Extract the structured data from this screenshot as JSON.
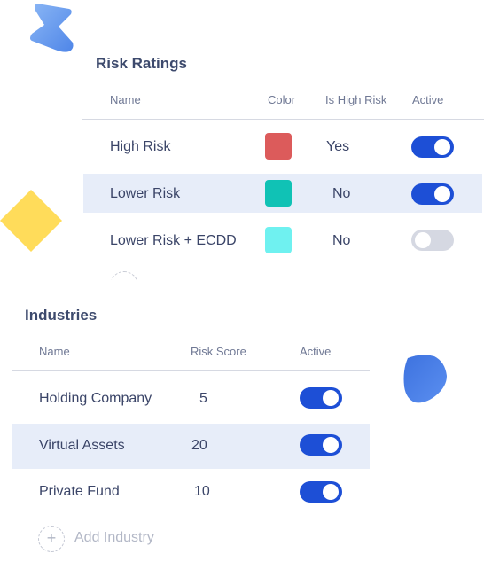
{
  "risk_ratings": {
    "title": "Risk Ratings",
    "columns": [
      "Name",
      "Color",
      "Is High Risk",
      "Active"
    ],
    "rows": [
      {
        "name": "High Risk",
        "color": "#dc5b5b",
        "is_high_risk": "Yes",
        "active": true
      },
      {
        "name": "Lower Risk",
        "color": "#10c2b5",
        "is_high_risk": "No",
        "active": true
      },
      {
        "name": "Lower Risk + ECDD",
        "color": "#6ff1f0",
        "is_high_risk": "No",
        "active": false
      }
    ]
  },
  "industries": {
    "title": "Industries",
    "columns": [
      "Name",
      "Risk Score",
      "Active"
    ],
    "rows": [
      {
        "name": "Holding Company",
        "risk_score": "5",
        "active": true
      },
      {
        "name": "Virtual Assets",
        "risk_score": "20",
        "active": true
      },
      {
        "name": "Private Fund",
        "risk_score": "10",
        "active": true
      }
    ],
    "add_label": "Add Industry"
  },
  "colors": {
    "accent": "#1d4fd6",
    "highlight_row": "#e7edf9",
    "toggle_off": "#d5d8e2"
  },
  "icons": {
    "add": "plus-icon"
  }
}
